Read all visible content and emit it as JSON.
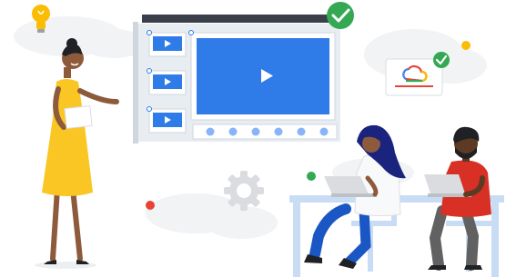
{
  "illustration": {
    "colors": {
      "screen_blue": "#2f7be8",
      "frame_grey": "#cfd6de",
      "dark_bar": "#3a3f4a",
      "check_green": "#34a853",
      "dot_red": "#ea4335",
      "sun_yellow": "#fbbc04",
      "dress_yellow": "#f9c623",
      "shirt_red": "#d93025",
      "jeans_blue": "#1a56c4",
      "table_blue": "#c8dcf5",
      "cloud_grey": "#f1f3f4",
      "gear_grey": "#dadce0"
    },
    "icons": [
      "lightbulb-icon",
      "play-icon",
      "checkmark-icon",
      "google-cloud-logo-icon",
      "gear-icon",
      "laptop-icon"
    ]
  }
}
